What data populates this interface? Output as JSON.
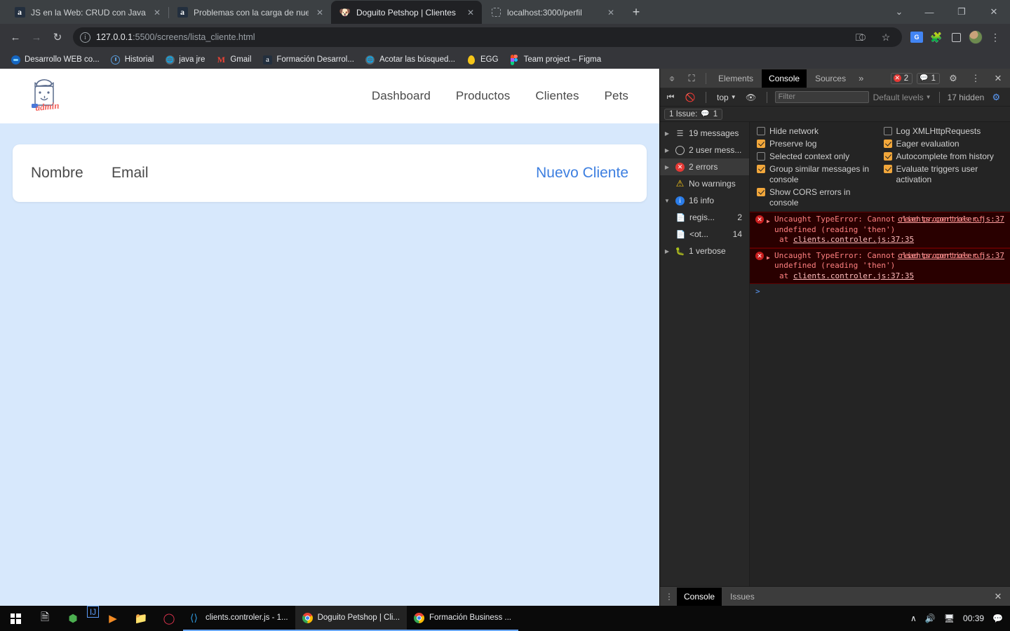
{
  "browser": {
    "tabs": [
      {
        "title": "JS en la Web: CRUD con JavaScrip",
        "favicon": "amazon-icon",
        "active": false
      },
      {
        "title": "Problemas con la carga de nuevo",
        "favicon": "amazon-icon",
        "active": false
      },
      {
        "title": "Doguito Petshop | Clientes",
        "favicon": "dog-icon",
        "active": true
      },
      {
        "title": "localhost:3000/perfil",
        "favicon": "generic-page-icon",
        "active": false
      }
    ],
    "new_tab_label": "+",
    "window_controls": {
      "chevron": "⌄",
      "minimize": "—",
      "maximize": "❐",
      "close": "✕"
    },
    "nav": {
      "back": "←",
      "forward": "→",
      "reload": "↻"
    },
    "omnibox": {
      "site_info_icon": "info-icon",
      "url_host": "127.0.0.1",
      "url_rest": ":5500/screens/lista_cliente.html",
      "share_icon": "share-icon",
      "bookmark_icon": "star-icon"
    },
    "toolbar_icons": [
      "translate-icon",
      "extensions-icon",
      "side-panel-icon",
      "profile-avatar",
      "chrome-menu-icon"
    ],
    "bookmarks": [
      {
        "label": "Desarrollo WEB co...",
        "icon": "blue-circle-icon"
      },
      {
        "label": "Historial",
        "icon": "history-icon"
      },
      {
        "label": "java jre",
        "icon": "globe-icon"
      },
      {
        "label": "Gmail",
        "icon": "gmail-icon"
      },
      {
        "label": "Formación Desarrol...",
        "icon": "amazon-icon"
      },
      {
        "label": "Acotar las búsqued...",
        "icon": "globe-icon"
      },
      {
        "label": "EGG",
        "icon": "egg-icon"
      },
      {
        "label": "Team project – Figma",
        "icon": "figma-icon"
      }
    ]
  },
  "page": {
    "logo_alt": "doguito-admin-logo",
    "nav": [
      {
        "label": "Dashboard"
      },
      {
        "label": "Productos"
      },
      {
        "label": "Clientes"
      },
      {
        "label": "Pets"
      }
    ],
    "table_header": {
      "col_nombre": "Nombre",
      "col_email": "Email",
      "new_client": "Nuevo Cliente"
    },
    "colors": {
      "background": "#d7e8fc",
      "card": "#ffffff",
      "link": "#3d7fe0"
    }
  },
  "devtools": {
    "toolbar": {
      "inspect_icon": "inspect-icon",
      "device_icon": "device-toolbar-icon",
      "tabs": [
        {
          "label": "Elements",
          "active": false
        },
        {
          "label": "Console",
          "active": true
        },
        {
          "label": "Sources",
          "active": false
        }
      ],
      "more_tabs": "»",
      "error_count": "2",
      "message_count": "1",
      "settings_icon": "gear-icon",
      "kebab_icon": "more-options-icon",
      "close_icon": "close-icon"
    },
    "filterbar": {
      "sidebar_toggle_icon": "show-console-sidebar-icon",
      "clear_icon": "clear-console-icon",
      "context": "top",
      "eye_icon": "live-expression-icon",
      "filter_placeholder": "Filter",
      "filter_value": "",
      "levels": "Default levels",
      "hidden": "17 hidden",
      "settings_icon": "console-settings-icon"
    },
    "issues_bar": {
      "text": "1 Issue:",
      "count": "1",
      "icon": "issue-icon"
    },
    "sidebar": [
      {
        "label": "19 messages",
        "count": "",
        "icon": "messages-icon",
        "arrow": "▶",
        "indent": 0,
        "selected": false
      },
      {
        "label": "2 user mess...",
        "count": "",
        "icon": "user-message-icon",
        "arrow": "▶",
        "indent": 0,
        "selected": false
      },
      {
        "label": "2 errors",
        "count": "",
        "icon": "error-icon",
        "arrow": "▶",
        "indent": 0,
        "selected": true
      },
      {
        "label": "No warnings",
        "count": "",
        "icon": "warning-icon",
        "arrow": "",
        "indent": 0,
        "selected": false
      },
      {
        "label": "16 info",
        "count": "",
        "icon": "info-icon",
        "arrow": "▼",
        "indent": 0,
        "selected": false
      },
      {
        "label": "regis...",
        "count": "2",
        "icon": "file-icon",
        "arrow": "",
        "indent": 1,
        "selected": false
      },
      {
        "label": "<ot...",
        "count": "14",
        "icon": "file-icon",
        "arrow": "",
        "indent": 1,
        "selected": false
      },
      {
        "label": "1 verbose",
        "count": "",
        "icon": "verbose-icon",
        "arrow": "▶",
        "indent": 0,
        "selected": false
      }
    ],
    "settings": [
      {
        "label": "Hide network",
        "checked": false
      },
      {
        "label": "Log XMLHttpRequests",
        "checked": false
      },
      {
        "label": "Preserve log",
        "checked": true
      },
      {
        "label": "Eager evaluation",
        "checked": true
      },
      {
        "label": "Selected context only",
        "checked": false
      },
      {
        "label": "Autocomplete from history",
        "checked": true
      },
      {
        "label": "Group similar messages in console",
        "checked": true
      },
      {
        "label": "Evaluate triggers user activation",
        "checked": true
      },
      {
        "label": "Show CORS errors in console",
        "checked": true
      }
    ],
    "errors": [
      {
        "title": "Uncaught TypeError:",
        "message": "Cannot read properties of undefined (reading 'then')",
        "source": "clients.controler.js:37",
        "at_prefix": "at",
        "at_link": "clients.controler.js:37:35"
      },
      {
        "title": "Uncaught TypeError:",
        "message": "Cannot read properties of undefined (reading 'then')",
        "source": "clients.controler.js:37",
        "at_prefix": "at",
        "at_link": "clients.controler.js:37:35"
      }
    ],
    "prompt": ">",
    "drawer": {
      "tabs": [
        {
          "label": "Console",
          "active": true
        },
        {
          "label": "Issues",
          "active": false
        }
      ],
      "close_icon": "close-icon"
    }
  },
  "taskbar": {
    "start_icon": "windows-start-icon",
    "pinned": [
      "notepad-icon",
      "shield-icon",
      "intellij-icon",
      "vlc-icon",
      "explorer-icon",
      "opera-icon"
    ],
    "apps": [
      {
        "label": "clients.controler.js - 1...",
        "icon": "vscode-icon",
        "active": false
      },
      {
        "label": "Doguito Petshop | Cli...",
        "icon": "chrome-icon",
        "active": true
      },
      {
        "label": "Formación Business ...",
        "icon": "chrome-icon",
        "active": false
      }
    ],
    "tray": {
      "chevron": "∧",
      "volume": "volume-icon",
      "network": "network-icon",
      "clock": "00:39",
      "notifications": "notification-icon"
    }
  }
}
